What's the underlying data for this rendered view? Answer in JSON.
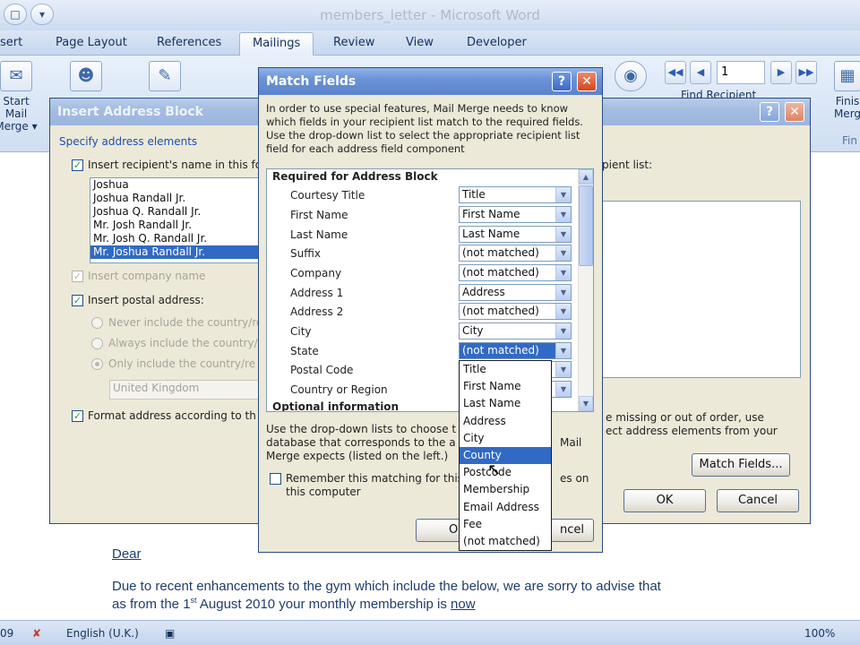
{
  "word": {
    "window_title": "members_letter - Microsoft Word",
    "tabs": [
      "sert",
      "Page Layout",
      "References",
      "Mailings",
      "Review",
      "View",
      "Developer"
    ],
    "active_tab": "Mailings",
    "ribbon": {
      "start_mail_merge_line1": "Start Mail",
      "start_mail_merge_line2": "Merge ▾",
      "finish_line1": "Finis",
      "finish_line2": "Merg",
      "finish_group": "Fin",
      "find_recipient": "Find Recipient",
      "record_number": "1"
    },
    "document": {
      "salutation": "Dear",
      "line1": "Due to recent enhancements to the gym which include the below, we are sorry to advise that",
      "line2_prefix": "as from the 1",
      "line2_sup": "st",
      "line2_middle": " August 2010 your monthly membership is ",
      "line2_link": "now"
    },
    "statusbar": {
      "page": "09",
      "language": "English (U.K.)",
      "zoom": "100%"
    }
  },
  "insert_address_block": {
    "title": "Insert Address Block",
    "specify_label": "Specify address elements",
    "insert_name_label": "Insert recipient's name in this fo",
    "name_formats": [
      "Joshua",
      "Joshua Randall Jr.",
      "Joshua Q. Randall Jr.",
      "Mr. Josh Randall Jr.",
      "Mr. Josh Q. Randall Jr.",
      "Mr. Joshua Randall Jr."
    ],
    "selected_name_format": "Mr. Joshua Randall Jr.",
    "insert_company_label": "Insert company name",
    "insert_postal_label": "Insert postal address:",
    "never_country": "Never include the country/re",
    "always_country": "Always include the country/re",
    "only_country": "Only include the country/re",
    "country_value": "United Kingdom",
    "format_label": "Format address according to th",
    "recipient_list_label": "pient list:",
    "correct_text_1": "e missing or out of order, use",
    "correct_text_2": "ect address elements from your",
    "match_fields_button": "Match Fields...",
    "ok_button": "OK",
    "cancel_button": "Cancel"
  },
  "match_fields": {
    "title": "Match Fields",
    "intro": "In order to use special features, Mail Merge needs to know which fields in your recipient list match to the required fields. Use the drop-down list to select the appropriate recipient list field for each address field component",
    "required_header": "Required for Address Block",
    "fields": [
      {
        "label": "Courtesy Title",
        "value": "Title"
      },
      {
        "label": "First Name",
        "value": "First Name"
      },
      {
        "label": "Last Name",
        "value": "Last Name"
      },
      {
        "label": "Suffix",
        "value": "(not matched)"
      },
      {
        "label": "Company",
        "value": "(not matched)"
      },
      {
        "label": "Address 1",
        "value": "Address"
      },
      {
        "label": "Address 2",
        "value": "(not matched)"
      },
      {
        "label": "City",
        "value": "City"
      },
      {
        "label": "State",
        "value": "(not matched)"
      },
      {
        "label": "Postal Code",
        "value": ""
      },
      {
        "label": "Country or Region",
        "value": ""
      }
    ],
    "optional_header": "Optional information",
    "bottom_text_1": "Use the drop-down lists to choose t",
    "bottom_text_2": "database that corresponds to the a",
    "bottom_text_3": "Merge expects (listed on the left.)",
    "bottom_text_2_end": "Mail",
    "remember_label_1": "Remember this matching for this",
    "remember_label_1_end": "es on",
    "remember_label_2": "this computer",
    "ok_button": "O",
    "cancel_button": "ncel",
    "dropdown_options": [
      "Title",
      "First Name",
      "Last Name",
      "Address",
      "City",
      "County",
      "Postcode",
      "Membership",
      "Email Address",
      "Fee",
      "(not matched)"
    ],
    "highlighted_option": "County"
  },
  "colors": {
    "selection": "#316ac5",
    "dialog_face": "#ece9d8",
    "title_blue": "#5b83cb"
  }
}
